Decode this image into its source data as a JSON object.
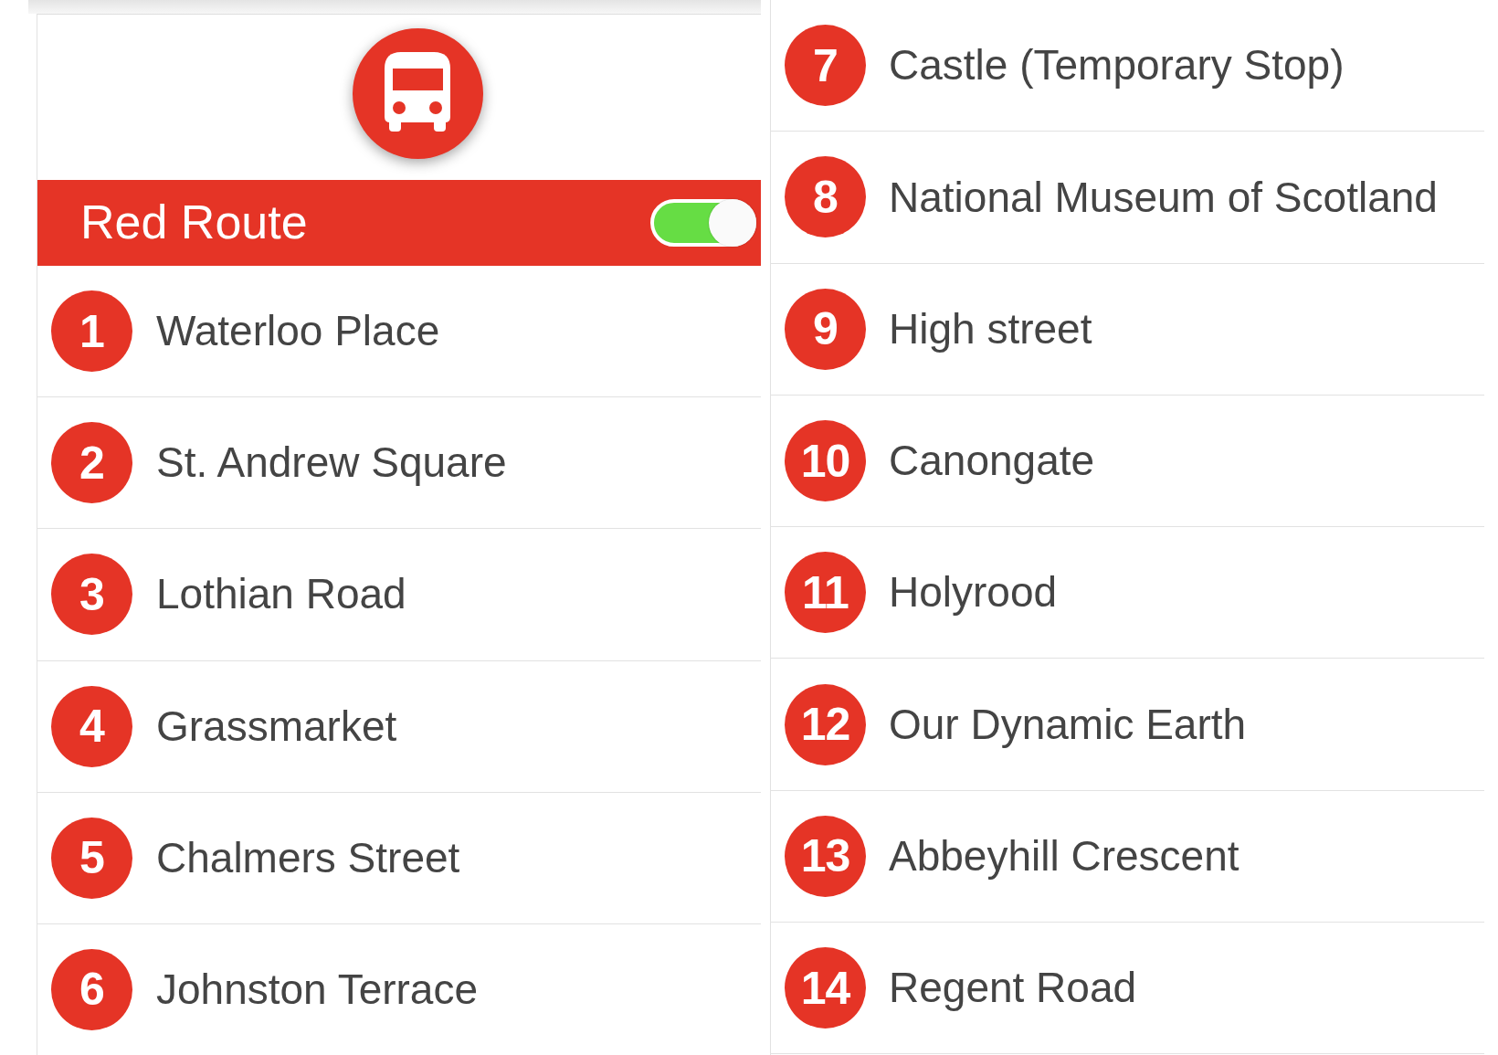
{
  "left_panel": {
    "route_title": "Red Route",
    "route_enabled": true,
    "stops": [
      {
        "number": "1",
        "name": "Waterloo Place"
      },
      {
        "number": "2",
        "name": "St. Andrew Square"
      },
      {
        "number": "3",
        "name": "Lothian Road"
      },
      {
        "number": "4",
        "name": "Grassmarket"
      },
      {
        "number": "5",
        "name": "Chalmers Street"
      },
      {
        "number": "6",
        "name": "Johnston Terrace"
      }
    ]
  },
  "right_panel": {
    "stops": [
      {
        "number": "7",
        "name": "Castle (Temporary Stop)"
      },
      {
        "number": "8",
        "name": "National Museum of Scotland"
      },
      {
        "number": "9",
        "name": "High street"
      },
      {
        "number": "10",
        "name": "Canongate"
      },
      {
        "number": "11",
        "name": "Holyrood"
      },
      {
        "number": "12",
        "name": "Our Dynamic Earth"
      },
      {
        "number": "13",
        "name": "Abbeyhill Crescent"
      },
      {
        "number": "14",
        "name": "Regent Road"
      }
    ]
  }
}
